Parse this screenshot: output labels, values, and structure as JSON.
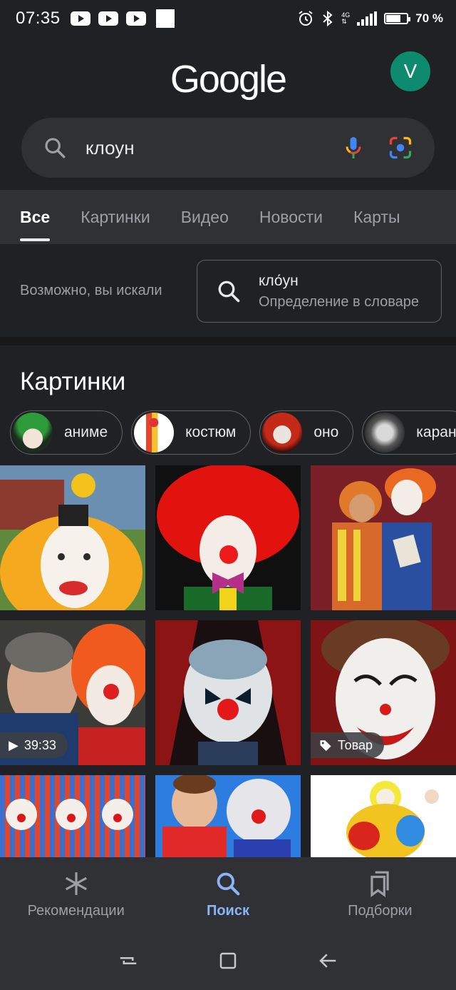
{
  "status_bar": {
    "time": "07:35",
    "network": "4G",
    "battery": "70 %"
  },
  "header": {
    "logo": "Google",
    "avatar_letter": "V"
  },
  "search": {
    "query": "клоун"
  },
  "tabs": [
    {
      "label": "Все",
      "active": true
    },
    {
      "label": "Картинки"
    },
    {
      "label": "Видео"
    },
    {
      "label": "Новости"
    },
    {
      "label": "Карты"
    }
  ],
  "suggestion": {
    "prompt": "Возможно, вы искали",
    "word": "кло́ун",
    "subtitle": "Определение в словаре"
  },
  "images_section": {
    "title": "Картинки",
    "chips": [
      "аниме",
      "костюм",
      "оно",
      "каран"
    ],
    "badges": {
      "video_duration": "39:33",
      "product": "Товар"
    }
  },
  "bottom_nav": {
    "discover": "Рекомендации",
    "search": "Поиск",
    "collections": "Подборки"
  },
  "colors": {
    "accent": "#8ab4f8",
    "background": "#202124",
    "surface": "#303134"
  }
}
